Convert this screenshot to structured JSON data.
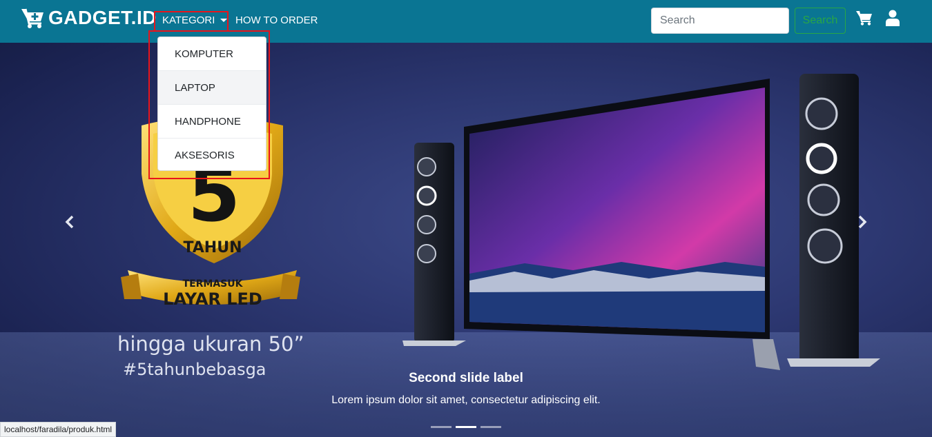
{
  "navbar": {
    "brand": "GADGET.ID",
    "brand_icon": "cart-plus-icon",
    "kategori_label": "KATEGORI",
    "how_to_order_label": "HOW TO ORDER",
    "search_placeholder": "Search",
    "search_button_label": "Search",
    "cart_icon": "shopping-cart-icon",
    "user_icon": "user-icon",
    "bg_color": "#0a7593",
    "button_accent": "#28a745"
  },
  "dropdown": {
    "items": [
      {
        "label": "KOMPUTER"
      },
      {
        "label": "LAPTOP"
      },
      {
        "label": "HANDPHONE"
      },
      {
        "label": "AKSESORIS"
      }
    ],
    "highlight_color": "#e8141b"
  },
  "carousel": {
    "caption_title": "Second slide label",
    "caption_text": "Lorem ipsum dolor sit amet, consectetur adipiscing elit.",
    "active_index": 1,
    "indicator_count": 3,
    "prev_icon": "chevron-left-icon",
    "next_icon": "chevron-right-icon",
    "promo": {
      "badge_number": "5",
      "badge_word": "TAHUN",
      "ribbon_top": "TERMASUK",
      "ribbon_main": "LAYAR LED",
      "line1": "hingga ukuran 50”",
      "line2": "#5tahunbebasga"
    }
  },
  "status_bar": {
    "url": "localhost/faradila/produk.html"
  }
}
